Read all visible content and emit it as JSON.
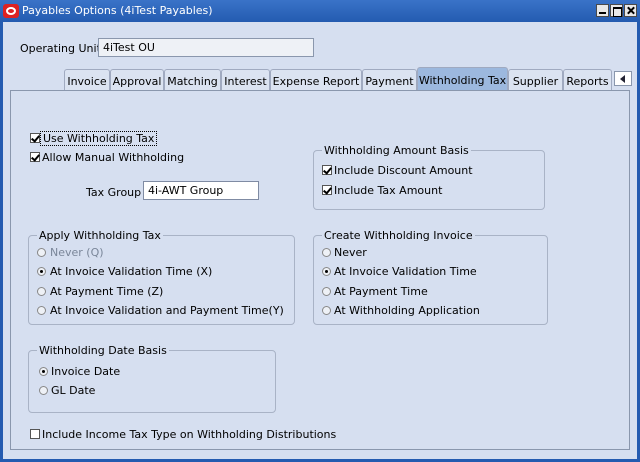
{
  "window": {
    "title": "Payables Options (4iTest Payables)"
  },
  "operating_unit": {
    "label": "Operating Unit",
    "value": "4iTest OU"
  },
  "tabs": [
    {
      "label": "Invoice"
    },
    {
      "label": "Approval"
    },
    {
      "label": "Matching"
    },
    {
      "label": "Interest"
    },
    {
      "label": "Expense Report"
    },
    {
      "label": "Payment"
    },
    {
      "label": "Withholding Tax"
    },
    {
      "label": "Supplier"
    },
    {
      "label": "Reports"
    }
  ],
  "options": {
    "use_withholding_tax": "Use Withholding Tax",
    "allow_manual_withholding": "Allow Manual Withholding",
    "tax_group_label": "Tax Group",
    "tax_group_value": "4i-AWT Group",
    "include_income_tax_type": "Include Income Tax Type on Withholding Distributions"
  },
  "withholding_amount_basis": {
    "title": "Withholding Amount Basis",
    "include_discount_amount": "Include Discount Amount",
    "include_tax_amount": "Include Tax Amount"
  },
  "apply_withholding_tax": {
    "title": "Apply Withholding Tax",
    "never": "Never (Q)",
    "invoice_validation_time": "At Invoice Validation Time (X)",
    "payment_time": "At Payment Time (Z)",
    "invoice_validation_and_payment_time": "At Invoice Validation and Payment Time(Y)"
  },
  "create_withholding_invoice": {
    "title": "Create Withholding Invoice",
    "never": "Never",
    "invoice_validation_time": "At Invoice Validation Time",
    "payment_time": "At Payment Time",
    "withholding_application": "At Withholding Application"
  },
  "withholding_date_basis": {
    "title": "Withholding Date Basis",
    "invoice_date": "Invoice Date",
    "gl_date": "GL Date"
  }
}
